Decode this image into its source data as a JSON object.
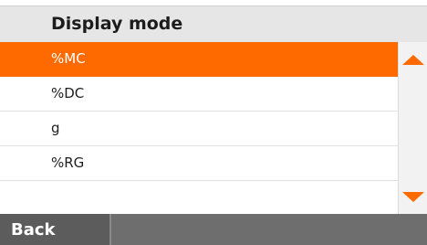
{
  "header": {
    "title": "Display mode"
  },
  "list": {
    "items": [
      {
        "label": "%MC",
        "selected": true
      },
      {
        "label": "%DC",
        "selected": false
      },
      {
        "label": "g",
        "selected": false
      },
      {
        "label": "%RG",
        "selected": false
      }
    ]
  },
  "scrollbar": {
    "up_icon": "triangle-up-icon",
    "down_icon": "triangle-down-icon"
  },
  "footer": {
    "back_label": "Back"
  },
  "colors": {
    "accent": "#ff6a00",
    "header_bg": "#e6e6e6",
    "footer_bg": "#6e6e6e",
    "back_bg": "#5c5c5c"
  }
}
